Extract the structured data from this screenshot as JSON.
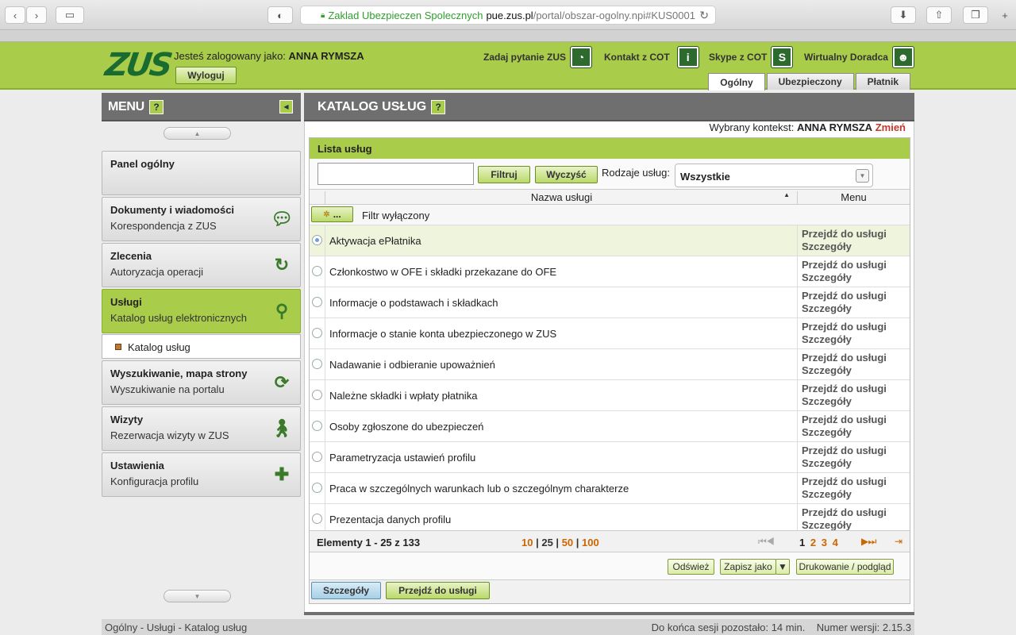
{
  "browser": {
    "url_org": "Zaklad Ubezpieczen Spolecznych",
    "url_host": "pue.zus.pl",
    "url_path": "/portal/obszar-ogolny.npi#KUS0001"
  },
  "header": {
    "logo_text": "ZUS",
    "logged_in_prefix": "Jesteś zalogowany jako:",
    "user_name": "ANNA RYMSZA",
    "logout_label": "Wyloguj",
    "links": [
      {
        "label": "Zadaj pytanie ZUS",
        "icon": "question-bubble-icon"
      },
      {
        "label": "Kontakt z COT",
        "icon": "info-icon"
      },
      {
        "label": "Skype z COT",
        "icon": "skype-icon"
      },
      {
        "label": "Wirtualny Doradca",
        "icon": "person-icon"
      }
    ],
    "context_tabs": [
      "Ogólny",
      "Ubezpieczony",
      "Płatnik"
    ],
    "active_context_tab": "Ogólny"
  },
  "sidebar": {
    "title": "MENU",
    "help": "?",
    "items": [
      {
        "title": "Panel ogólny",
        "subtitle": "",
        "icon": ""
      },
      {
        "title": "Dokumenty i wiadomości",
        "subtitle": "Korespondencja z ZUS",
        "icon": "speech-bubble-icon"
      },
      {
        "title": "Zlecenia",
        "subtitle": "Autoryzacja operacji",
        "icon": "refresh-icon"
      },
      {
        "title": "Usługi",
        "subtitle": "Katalog usług elektronicznych",
        "icon": "services-icon"
      },
      {
        "title": "Wyszukiwanie, mapa strony",
        "subtitle": "Wyszukiwanie na portalu",
        "icon": "sync-icon"
      },
      {
        "title": "Wizyty",
        "subtitle": "Rezerwacja wizyty w ZUS",
        "icon": "walking-person-icon"
      },
      {
        "title": "Ustawienia",
        "subtitle": "Konfiguracja profilu",
        "icon": "puzzle-icon"
      }
    ],
    "sub_item": "Katalog usług"
  },
  "main": {
    "title": "KATALOG USŁUG",
    "help": "?",
    "context_prefix": "Wybrany kontekst:",
    "context_name": "ANNA RYMSZA",
    "change_label": "Zmień",
    "list_title": "Lista usług",
    "filter_button": "Filtruj",
    "clear_button": "Wyczyść",
    "service_type_label": "Rodzaje usług:",
    "service_type_value": "Wszystkie",
    "col_name": "Nazwa usługi",
    "col_menu": "Menu",
    "filter_menu_button": "...",
    "filter_state": "Filtr wyłączony",
    "rows": [
      {
        "name": "Aktywacja ePłatnika",
        "action1": "Przejdź do usługi",
        "action2": "Szczegóły"
      },
      {
        "name": "Członkostwo w OFE i składki przekazane do OFE",
        "action1": "Przejdź do usługi",
        "action2": "Szczegóły"
      },
      {
        "name": "Informacje o podstawach i składkach",
        "action1": "Przejdź do usługi",
        "action2": "Szczegóły"
      },
      {
        "name": "Informacje o stanie konta ubezpieczonego w ZUS",
        "action1": "Przejdź do usługi",
        "action2": "Szczegóły"
      },
      {
        "name": "Nadawanie i odbieranie upoważnień",
        "action1": "Przejdź do usługi",
        "action2": "Szczegóły"
      },
      {
        "name": "Należne składki i wpłaty płatnika",
        "action1": "Przejdź do usługi",
        "action2": "Szczegóły"
      },
      {
        "name": "Osoby zgłoszone do ubezpieczeń",
        "action1": "Przejdź do usługi",
        "action2": "Szczegóły"
      },
      {
        "name": "Parametryzacja ustawień profilu",
        "action1": "Przejdź do usługi",
        "action2": "Szczegóły"
      },
      {
        "name": "Praca w szczególnych warunkach lub o szczególnym charakterze",
        "action1": "Przejdź do usługi",
        "action2": "Szczegóły"
      },
      {
        "name": "Prezentacja danych profilu",
        "action1": "Przejdź do usługi",
        "action2": "Szczegóły"
      }
    ],
    "pager": {
      "count": "Elementy 1 - 25 z 133",
      "sizes": [
        "10",
        "25",
        "50",
        "100"
      ],
      "current_size": "25",
      "pages": [
        "1",
        "2",
        "3",
        "4"
      ],
      "current_page": "1"
    },
    "refresh_button": "Odśwież",
    "save_as_button": "Zapisz jako",
    "print_button": "Drukowanie / podgląd",
    "details_button": "Szczegóły",
    "go_to_button": "Przejdź do usługi"
  },
  "footer": {
    "breadcrumb": "Ogólny - Usługi - Katalog usług",
    "session": "Do końca sesji pozostało: 14 min.",
    "version": "Numer wersji: 2.15.3"
  },
  "colors": {
    "brand_green": "#a9cc4b",
    "dark_green": "#1a6b2f",
    "header_grey": "#6f6f6f",
    "link_orange": "#cc6600"
  }
}
